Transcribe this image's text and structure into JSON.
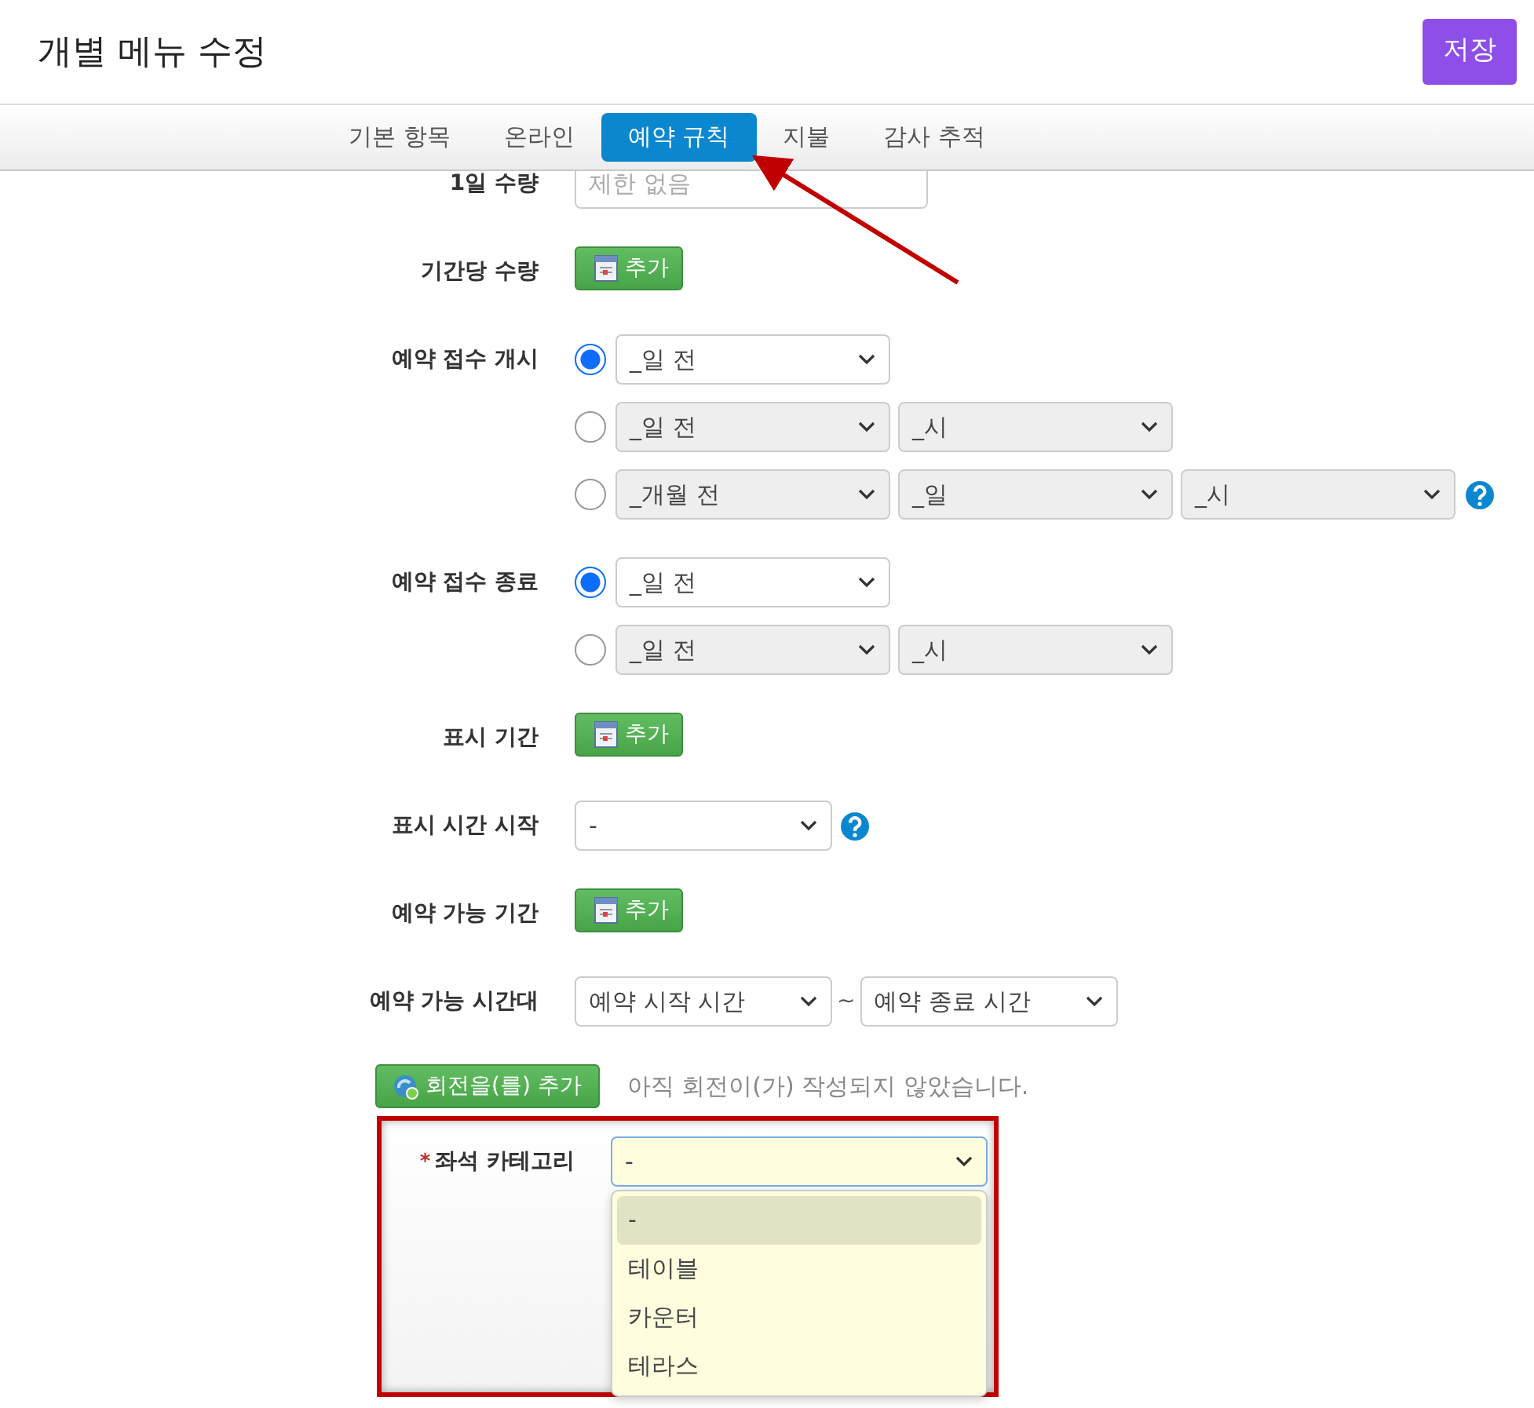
{
  "header": {
    "title": "개별 메뉴 수정",
    "save_button": "저장"
  },
  "tabs": [
    {
      "label": "기본 항목",
      "selected": false
    },
    {
      "label": "온라인",
      "selected": false
    },
    {
      "label": "예약 규칙",
      "selected": true
    },
    {
      "label": "지불",
      "selected": false
    },
    {
      "label": "감사 추적",
      "selected": false
    }
  ],
  "form": [
    {
      "kind": "input",
      "label": "1일 수량",
      "placeholder": "제한 없음"
    },
    {
      "kind": "add",
      "label": "기간당 수량",
      "button": "추가"
    },
    {
      "kind": "radio-group",
      "label": "예약 접수 개시",
      "options": [
        {
          "selected": true,
          "help": false,
          "selects": [
            {
              "value": "_일 전",
              "disabled": false
            }
          ]
        },
        {
          "selected": false,
          "help": false,
          "selects": [
            {
              "value": "_일 전",
              "disabled": true
            },
            {
              "value": "_시",
              "disabled": true
            }
          ]
        },
        {
          "selected": false,
          "help": true,
          "selects": [
            {
              "value": "_개월 전",
              "disabled": true
            },
            {
              "value": "_일",
              "disabled": true
            },
            {
              "value": "_시",
              "disabled": true
            }
          ]
        }
      ]
    },
    {
      "kind": "radio-group",
      "label": "예약 접수 종료",
      "options": [
        {
          "selected": true,
          "help": false,
          "selects": [
            {
              "value": "_일 전",
              "disabled": false
            }
          ]
        },
        {
          "selected": false,
          "help": false,
          "selects": [
            {
              "value": "_일 전",
              "disabled": true
            },
            {
              "value": "_시",
              "disabled": true
            }
          ]
        }
      ]
    },
    {
      "kind": "add",
      "label": "표시 기간",
      "button": "추가"
    },
    {
      "kind": "select",
      "label": "표시 시간 시작",
      "value": "-",
      "help": true
    },
    {
      "kind": "add",
      "label": "예약 가능 기간",
      "button": "추가"
    },
    {
      "kind": "range",
      "label": "예약 가능 시간대",
      "start": "예약 시작 시간",
      "separator": "~",
      "end": "예약 종료 시간"
    }
  ],
  "rotation": {
    "button": "회전을(를) 추가",
    "message": "아직 회전이(가) 작성되지 않았습니다."
  },
  "seat_category": {
    "required_mark": "*",
    "label": "좌석 카테고리",
    "value": "-",
    "expanded": true,
    "options": [
      {
        "label": "-",
        "selected": true
      },
      {
        "label": "테이블",
        "selected": false
      },
      {
        "label": "카운터",
        "selected": false
      },
      {
        "label": "테라스",
        "selected": false
      }
    ]
  }
}
